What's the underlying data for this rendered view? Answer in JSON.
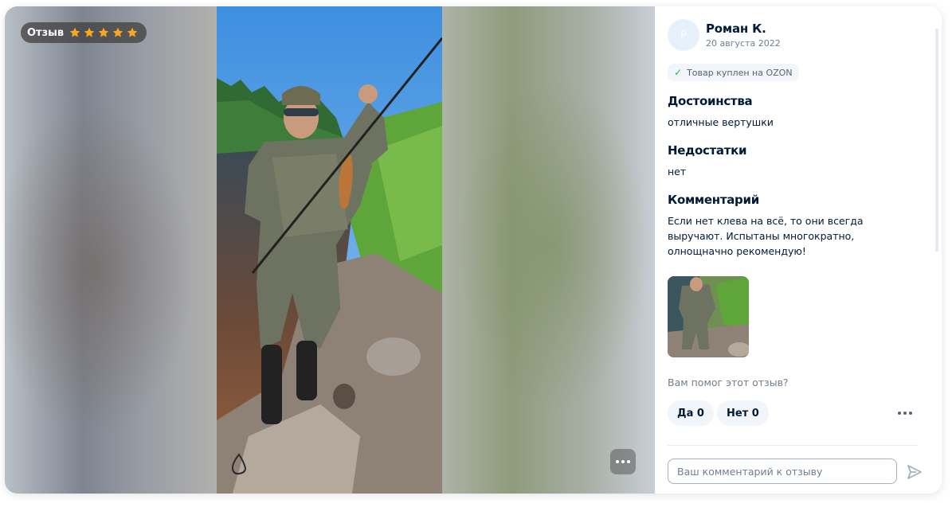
{
  "media": {
    "rating_label": "Отзыв",
    "rating": 5,
    "rating_max": 5,
    "star_color": "#f9a620"
  },
  "review": {
    "author_initial": "Р",
    "author_name": "Роман К.",
    "date": "20 августа 2022",
    "purchase_badge": "Товар куплен на OZON",
    "pros_title": "Достоинства",
    "pros_text": "отличные вертушки",
    "cons_title": "Недостатки",
    "cons_text": "нет",
    "comment_title": "Комментарий",
    "comment_text": "Если нет клева на всё, то они всегда выручают. Испытаны многократно, олнощначно рекомендую!"
  },
  "feedback": {
    "question": "Вам помог этот отзыв?",
    "yes_label": "Да 0",
    "no_label": "Нет 0"
  },
  "reply": {
    "placeholder": "Ваш комментарий к отзыву"
  },
  "icons": {
    "star": "star-icon",
    "check": "check-icon",
    "more": "more-horizontal-icon",
    "send": "send-icon"
  }
}
